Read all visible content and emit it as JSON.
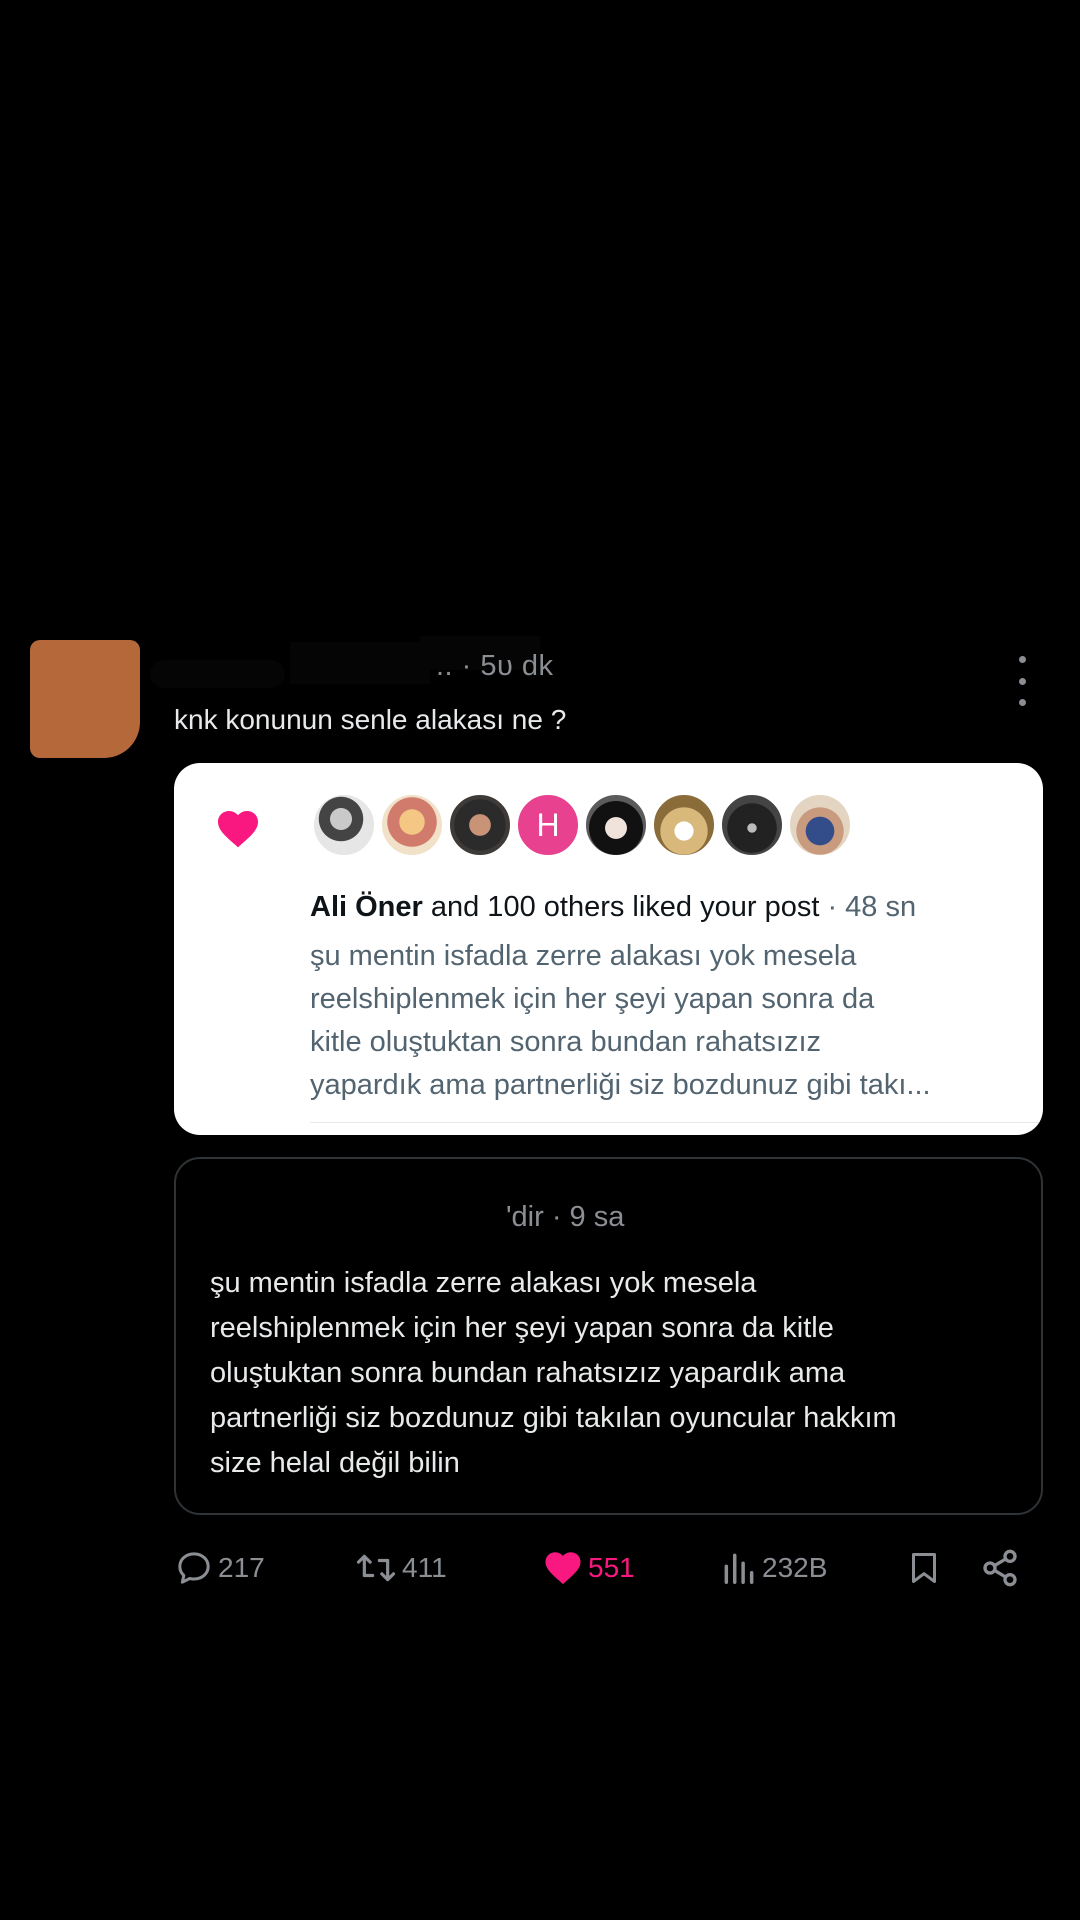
{
  "post": {
    "header_time": ".. · 5υ dk",
    "text": "knk konunun senle alakası ne ?"
  },
  "notification": {
    "heart_color": "#f91880",
    "avatar_letter": "H",
    "liker_name": "Ali Öner",
    "liked_text": " and 100 others liked your post",
    "time": " · 48 sn",
    "body_lines": [
      "şu mentin isfadla zerre alakası yok mesela",
      "reelshiplenmek için her şeyi yapan sonra da",
      "kitle oluştuktan sonra bundan rahatsızız",
      "yapardık ama partnerliği siz bozdunuz gibi takı..."
    ]
  },
  "quote": {
    "meta": "'dir · 9 sa",
    "body_lines": [
      "şu mentin isfadla zerre alakası yok mesela",
      "reelshiplenmek için her şeyi yapan sonra da kitle",
      "oluştuktan sonra bundan rahatsızız yapardık ama",
      "partnerliği siz bozdunuz gibi takılan oyuncular hakkım",
      "size helal değil bilin"
    ]
  },
  "actions": {
    "replies": "217",
    "reposts": "411",
    "likes": "551",
    "views": "232B",
    "like_color": "#f91880",
    "muted_color": "#8b8f94"
  }
}
